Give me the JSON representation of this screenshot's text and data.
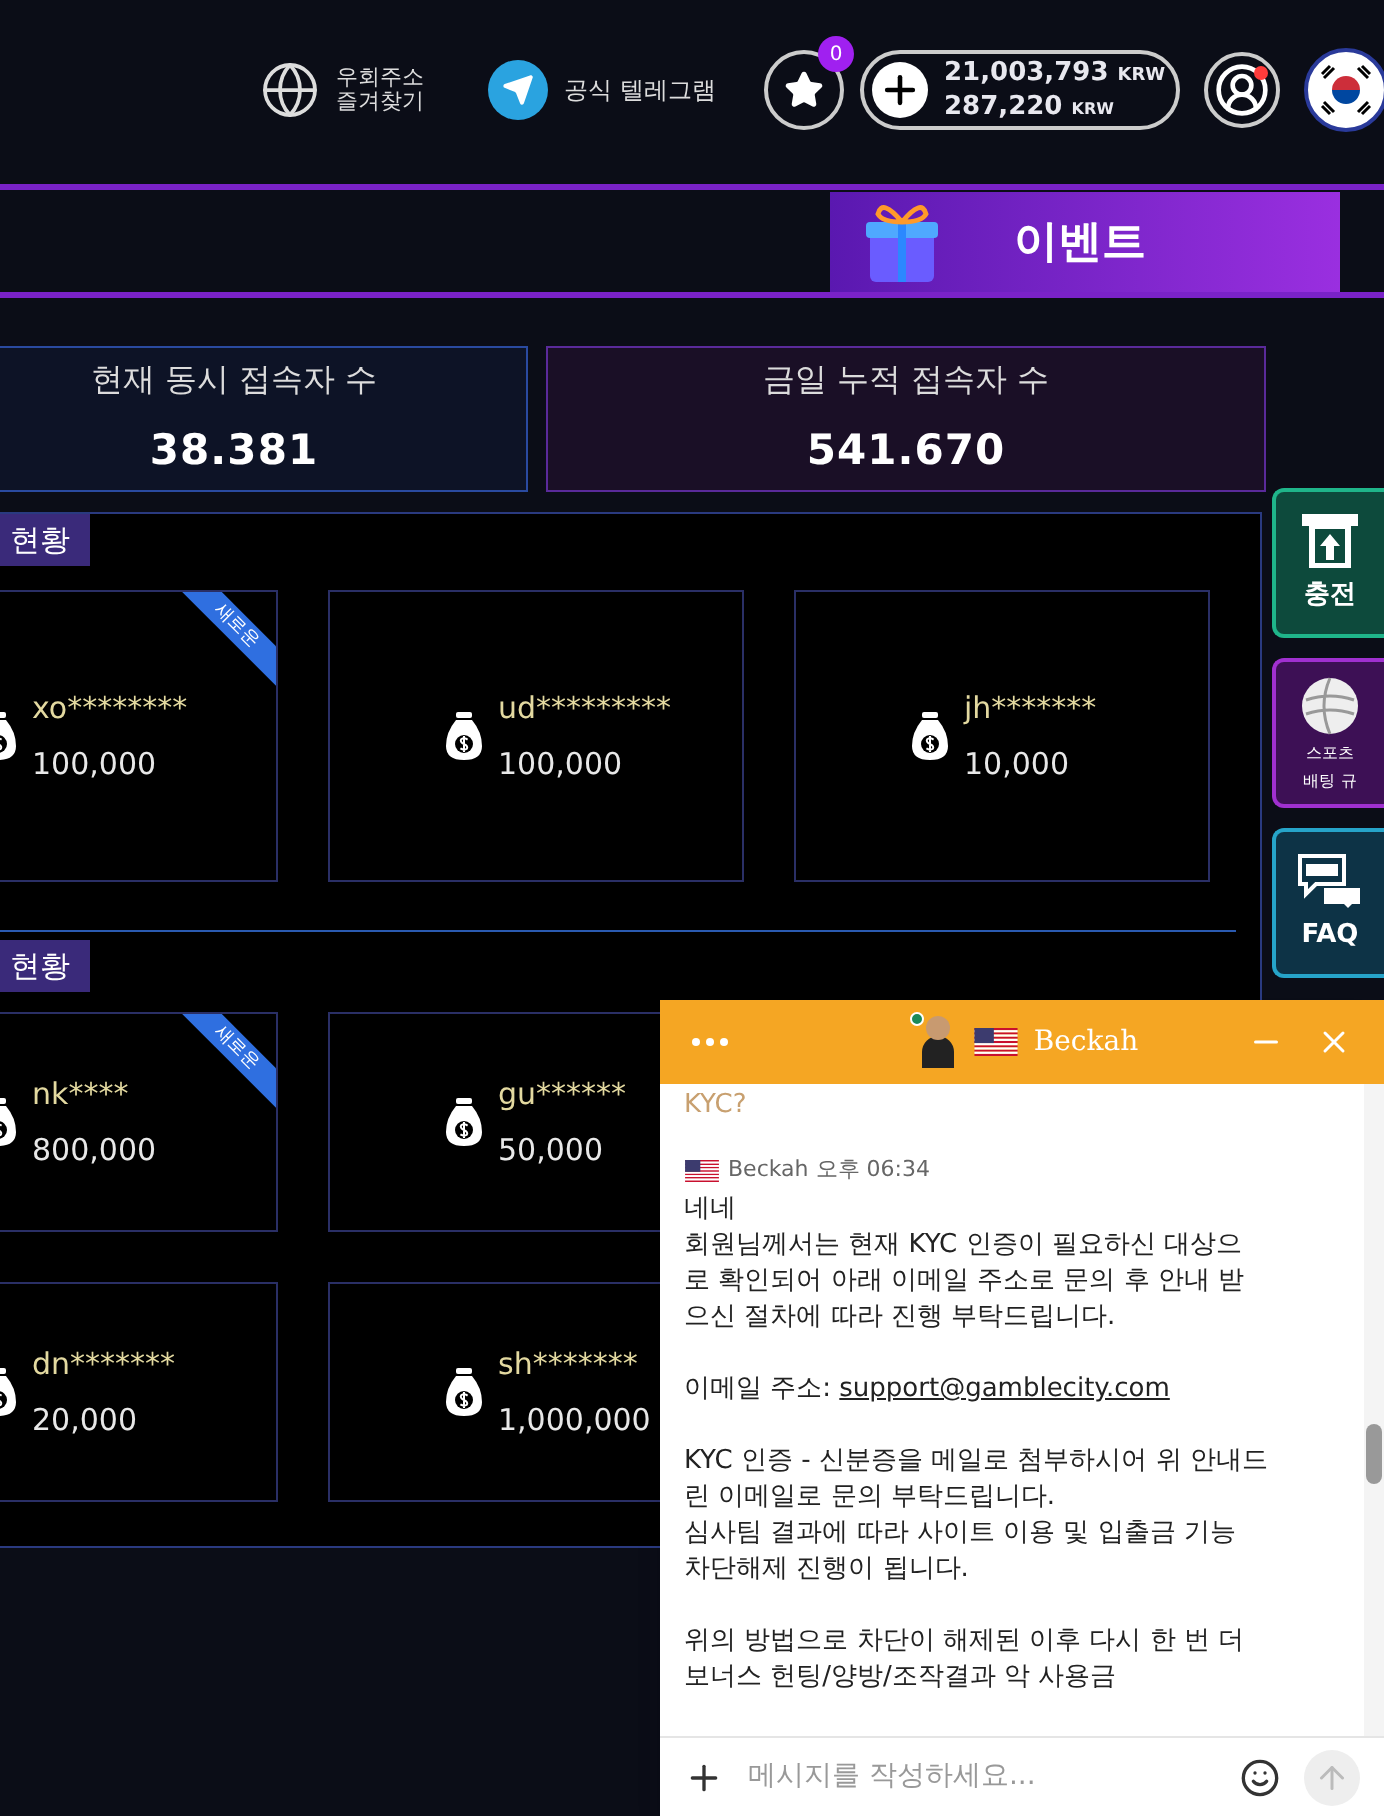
{
  "header": {
    "bypass_link": [
      "우회주소",
      "즐겨찾기"
    ],
    "telegram_link": "공식 텔레그램",
    "favorites": {
      "badge": "0"
    },
    "balance": {
      "primary": "21,003,793",
      "primary_unit": "KRW",
      "secondary": "287,220",
      "secondary_unit": "KRW"
    },
    "profile": {
      "notification": true
    }
  },
  "nav": {
    "event_tab": {
      "label": "이벤트",
      "selected": true
    }
  },
  "stats": [
    {
      "label": "현재 동시 접속자 수",
      "value": "38.381",
      "kind": "blue"
    },
    {
      "label": "금일 누적 접속자 수",
      "value": "541.670",
      "kind": "purple"
    }
  ],
  "sections": [
    {
      "title": "현황",
      "rows": [
        [
          {
            "name": "xo********",
            "amount": "100,000",
            "badge": "새로운"
          },
          {
            "name": "ud*********",
            "amount": "100,000"
          },
          {
            "name": "jh*******",
            "amount": "10,000"
          }
        ]
      ]
    },
    {
      "title": "현황",
      "rows": [
        [
          {
            "name": "nk****",
            "amount": "800,000",
            "badge": "새로운"
          },
          {
            "name": "gu******",
            "amount": "50,000"
          }
        ],
        [
          {
            "name": "dn*******",
            "amount": "20,000"
          },
          {
            "name": "sh*******",
            "amount": "1,000,000"
          }
        ]
      ]
    }
  ],
  "side_menu": [
    {
      "kind": "deposit",
      "lines": [
        "충전"
      ]
    },
    {
      "kind": "sports",
      "lines": [
        "스포츠",
        "배팅 규"
      ]
    },
    {
      "kind": "faq",
      "lines": [
        "FAQ"
      ]
    }
  ],
  "chat": {
    "agent": "Beckah",
    "online": true,
    "messages": [
      {
        "kind": "user",
        "text": "KYC?"
      },
      {
        "kind": "agent",
        "sender": "Beckah",
        "time": "오후 06:34",
        "paragraphs": [
          {
            "text": "네네\n회원님께서는 현재 KYC 인증이 필요하신 대상으로 확인되어 아래 이메일 주소로 문의 후 안내 받으신 절차에 따라 진행 부탁드립니다."
          },
          {
            "text": "이메일 주소: ",
            "link": "support@gamblecity.com"
          },
          {
            "text": "KYC 인증 - 신분증을 메일로 첨부하시어 위 안내드린 이메일로 문의 부탁드립니다.\n심사팀 결과에 따라 사이트 이용 및 입출금 기능 차단해제 진행이 됩니다."
          },
          {
            "text": "위의 방법으로 차단이 해제된 이후 다시 한 번 더 보너스 헌팅/양방/조작결과 악 사용금"
          }
        ]
      }
    ],
    "input": {
      "placeholder": "메시지를 작성하세요..."
    }
  }
}
